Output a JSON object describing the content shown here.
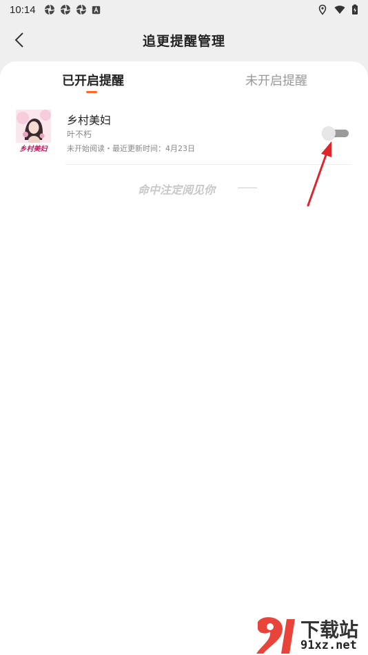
{
  "status_bar": {
    "time": "10:14"
  },
  "header": {
    "title": "追更提醒管理"
  },
  "tabs": [
    {
      "label": "已开启提醒",
      "active": true
    },
    {
      "label": "未开启提醒",
      "active": false
    }
  ],
  "book": {
    "title": "乡村美妇",
    "author": "叶不朽",
    "status": "未开始阅读・最近更新时间：4月23日",
    "cover_title": "乡村美妇",
    "reminder_enabled": false
  },
  "end_note": "命中注定阅见你",
  "watermark": {
    "top_text": "下载站",
    "bottom_text": "91xz.net"
  },
  "colors": {
    "accent": "#ff6a1a",
    "arrow": "#e0242b",
    "watermark_red": "#e8443a"
  }
}
